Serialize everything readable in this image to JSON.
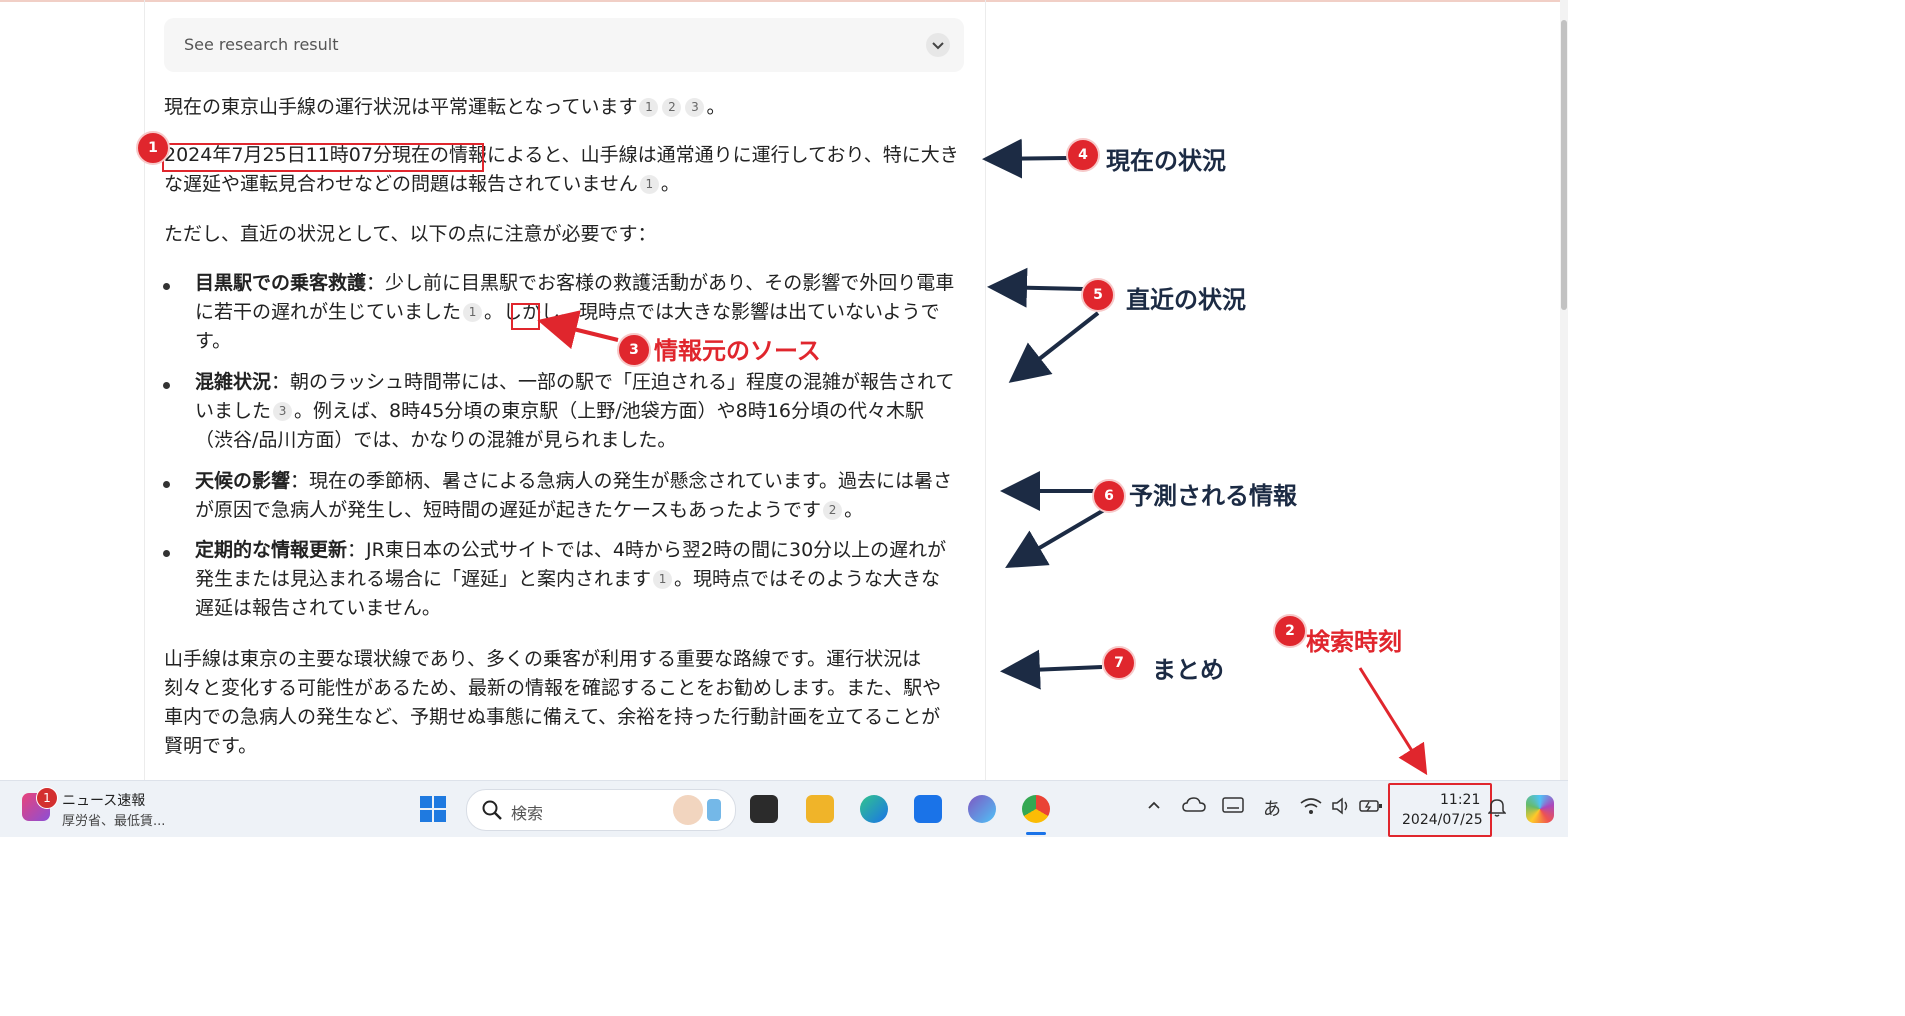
{
  "research": {
    "label": "See research result"
  },
  "content": {
    "intro": "現在の東京山手線の運行状況は平常運転となっています",
    "intro_cites": [
      "1",
      "2",
      "3"
    ],
    "intro_end": "。",
    "p2_highlight": "2024年7月25日11時07分現在の情報",
    "p2_rest": "によると、山手線は通常通りに運行しており、特に大きな遅延や運転見合わせなどの問題は報告されていません",
    "p2_cite": "1",
    "p2_end": "。",
    "p3": "ただし、直近の状況として、以下の点に注意が必要です：",
    "bullets": [
      {
        "title": "目黒駅での乗客救護",
        "text": "：少し前に目黒駅でお客様の救護活動があり、その影響で外回り電車に若干の遅れが生じていました",
        "cite": "1",
        "after": "。しかし、現時点では大きな影響は出ていないようです。"
      },
      {
        "title": "混雑状況",
        "text": "：朝のラッシュ時間帯には、一部の駅で「圧迫される」程度の混雑が報告されていました",
        "cite": "3",
        "after": "。例えば、8時45分頃の東京駅（上野/池袋方面）や8時16分頃の代々木駅（渋谷/品川方面）では、かなりの混雑が見られました。"
      },
      {
        "title": "天候の影響",
        "text": "：現在の季節柄、暑さによる急病人の発生が懸念されています。過去には暑さが原因で急病人が発生し、短時間の遅延が起きたケースもあったようです",
        "cite": "2",
        "after": "。"
      },
      {
        "title": "定期的な情報更新",
        "text": "：JR東日本の公式サイトでは、4時から翌2時の間に30分以上の遅れが発生または見込まれる場合に「遅延」と案内されます",
        "cite": "1",
        "after": "。現時点ではそのような大きな遅延は報告されていません。"
      }
    ],
    "summary": "山手線は東京の主要な環状線であり、多くの乗客が利用する重要な路線です。運行状況は刻々と変化する可能性があるため、最新の情報を確認することをお勧めします。また、駅や車内での急病人の発生など、予期せぬ事態に備えて、余裕を持った行動計画を立てることが賢明です。"
  },
  "annotations": {
    "n1": "1",
    "n2": "2",
    "n3": "3",
    "n4": "4",
    "n5": "5",
    "n6": "6",
    "n7": "7",
    "l2": "検索時刻",
    "l3": "情報元のソース",
    "l4": "現在の状況",
    "l5": "直近の状況",
    "l6": "予測される情報",
    "l7": "まとめ",
    "accent_red": "#e0262d",
    "arrow_navy": "#1c2b44"
  },
  "taskbar": {
    "news_badge": "1",
    "news_title": "ニュース速報",
    "news_sub": "厚労省、最低賃...",
    "search_placeholder": "検索",
    "ime": "あ",
    "time": "11:21",
    "date": "2024/07/25",
    "icons": [
      "windows-start-icon",
      "search-icon",
      "task-view-icon",
      "file-explorer-icon",
      "edge-icon",
      "mail-icon",
      "copilot-icon",
      "chrome-icon",
      "chevron-up-icon",
      "onedrive-icon",
      "keyboard-icon",
      "wifi-icon",
      "volume-icon",
      "battery-icon",
      "bell-icon",
      "copilot-pre-icon"
    ]
  }
}
